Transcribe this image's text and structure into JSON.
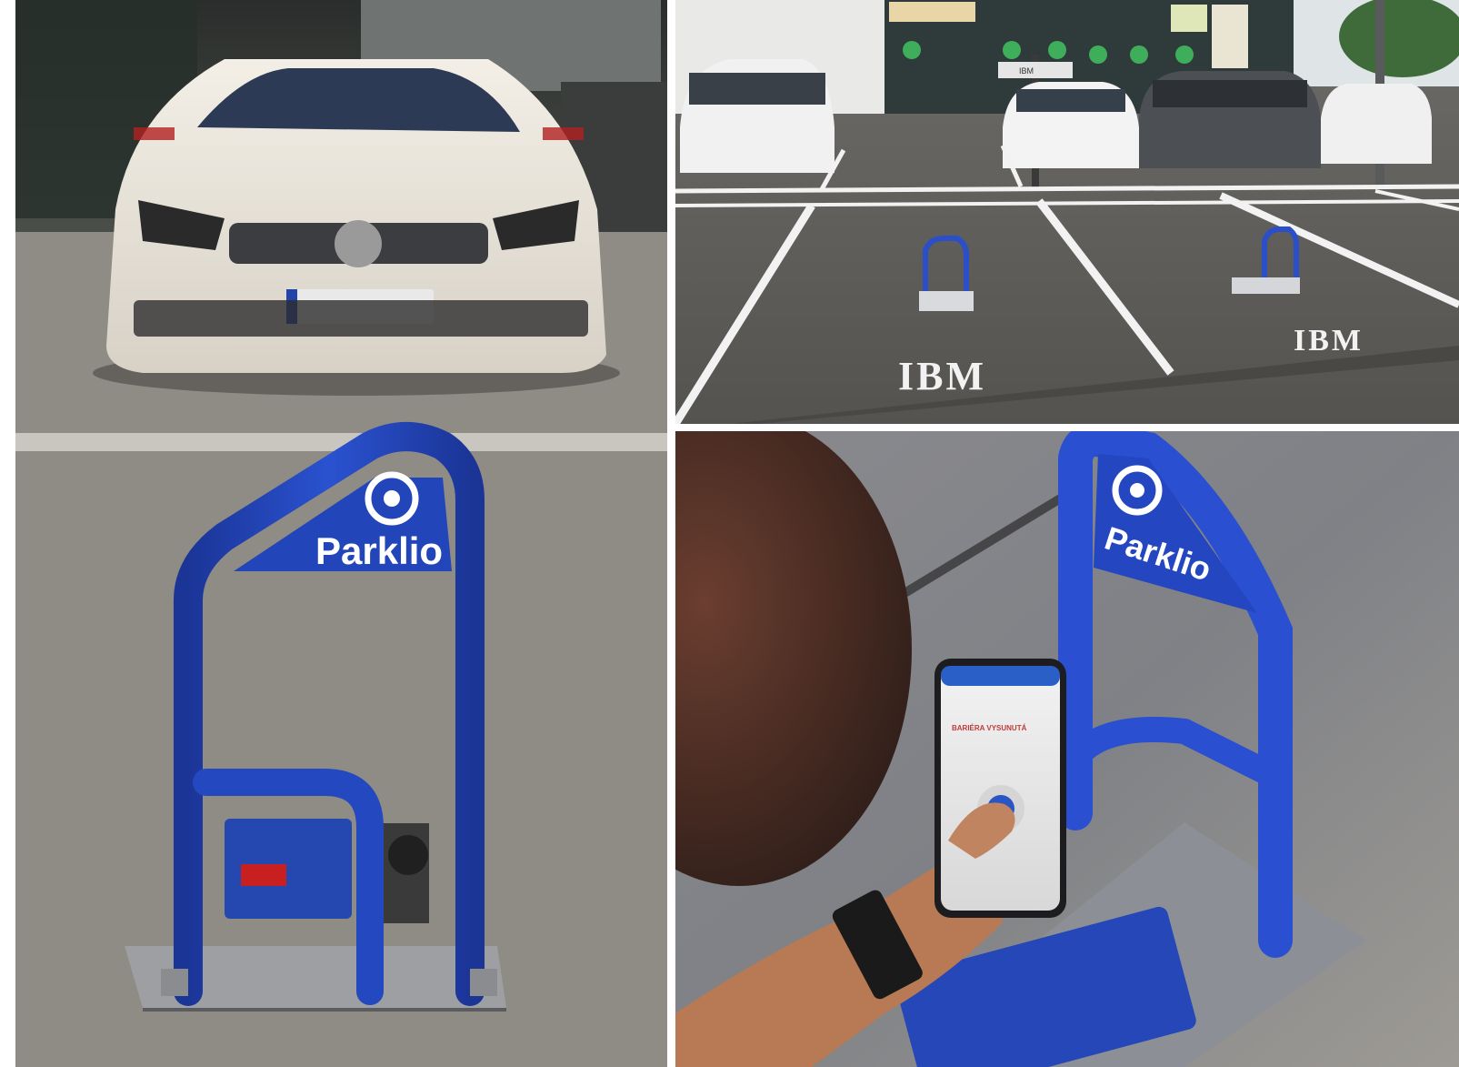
{
  "photos": {
    "left": {
      "brand_text": "Parklio"
    },
    "top_right": {
      "floor_text_1": "IBM",
      "floor_text_2": "IBM",
      "sign_text": "IBM"
    },
    "bottom_right": {
      "brand_text": "Parklio",
      "phone_title": "BARIÉRA VYSUNUTÁ",
      "phone_subtitle": ""
    }
  },
  "colors": {
    "barrier_blue": "#1f3fae",
    "asphalt": "#8d8a86",
    "paving": "#5f5d5a",
    "car_white": "#efe9df"
  }
}
